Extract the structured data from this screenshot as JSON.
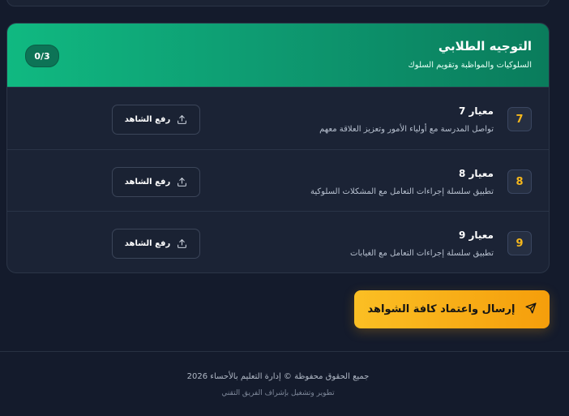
{
  "section": {
    "title": "التوجيه الطلابي",
    "subtitle": "السلوكيات والمواظبة وتقويم السلوك",
    "progress": "0/3",
    "header_colors": [
      "#10b981",
      "#0a7c5c"
    ]
  },
  "criteria": [
    {
      "number": "7",
      "title": "معيار 7",
      "description": "تواصل المدرسة مع أولياء الأمور وتعزيز العلاقة معهم",
      "upload_label": "رفع الشاهد"
    },
    {
      "number": "8",
      "title": "معيار 8",
      "description": "تطبيق سلسلة إجراءات التعامل مع المشكلات السلوكية",
      "upload_label": "رفع الشاهد"
    },
    {
      "number": "9",
      "title": "معيار 9",
      "description": "تطبيق سلسلة إجراءات التعامل مع الغيابات",
      "upload_label": "رفع الشاهد"
    }
  ],
  "submit": {
    "label": "إرسال واعتماد كافة الشواهد",
    "color": "#f59e0b"
  },
  "footer": {
    "copyright": "جميع الحقوق محفوظة © إدارة التعليم بالأحساء 2026",
    "credit": "تطوير وتشغيل بإشراف الفريق التقني"
  },
  "icons": {
    "upload": "upload-icon",
    "send": "send-icon"
  }
}
